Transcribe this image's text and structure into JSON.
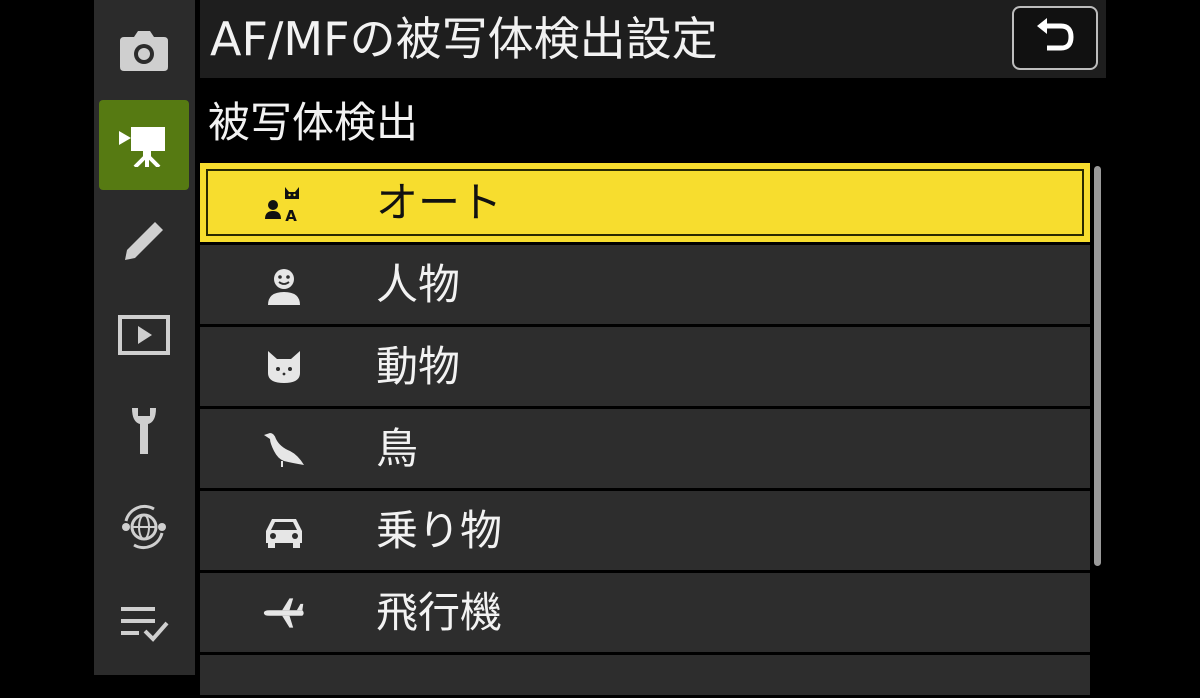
{
  "header": {
    "title": "AF/MFの被写体検出設定"
  },
  "subtitle": "被写体検出",
  "sidebar": {
    "items": [
      {
        "icon": "camera-icon"
      },
      {
        "icon": "movie-camera-icon",
        "active": true
      },
      {
        "icon": "pencil-icon"
      },
      {
        "icon": "playback-icon"
      },
      {
        "icon": "wrench-icon"
      },
      {
        "icon": "network-icon"
      },
      {
        "icon": "my-menu-icon"
      }
    ]
  },
  "list": {
    "items": [
      {
        "label": "オート",
        "icon": "auto-subject-icon",
        "selected": true
      },
      {
        "label": "人物",
        "icon": "person-icon"
      },
      {
        "label": "動物",
        "icon": "animal-icon"
      },
      {
        "label": "鳥",
        "icon": "bird-icon"
      },
      {
        "label": "乗り物",
        "icon": "vehicle-icon"
      },
      {
        "label": "飛行機",
        "icon": "airplane-icon"
      }
    ]
  },
  "colors": {
    "selected_bg": "#f7dd2e",
    "active_tab_bg": "#567a12",
    "row_bg": "#2d2d2d",
    "header_bg": "#1e1e1e",
    "sidebar_bg": "#2b2b2b"
  }
}
